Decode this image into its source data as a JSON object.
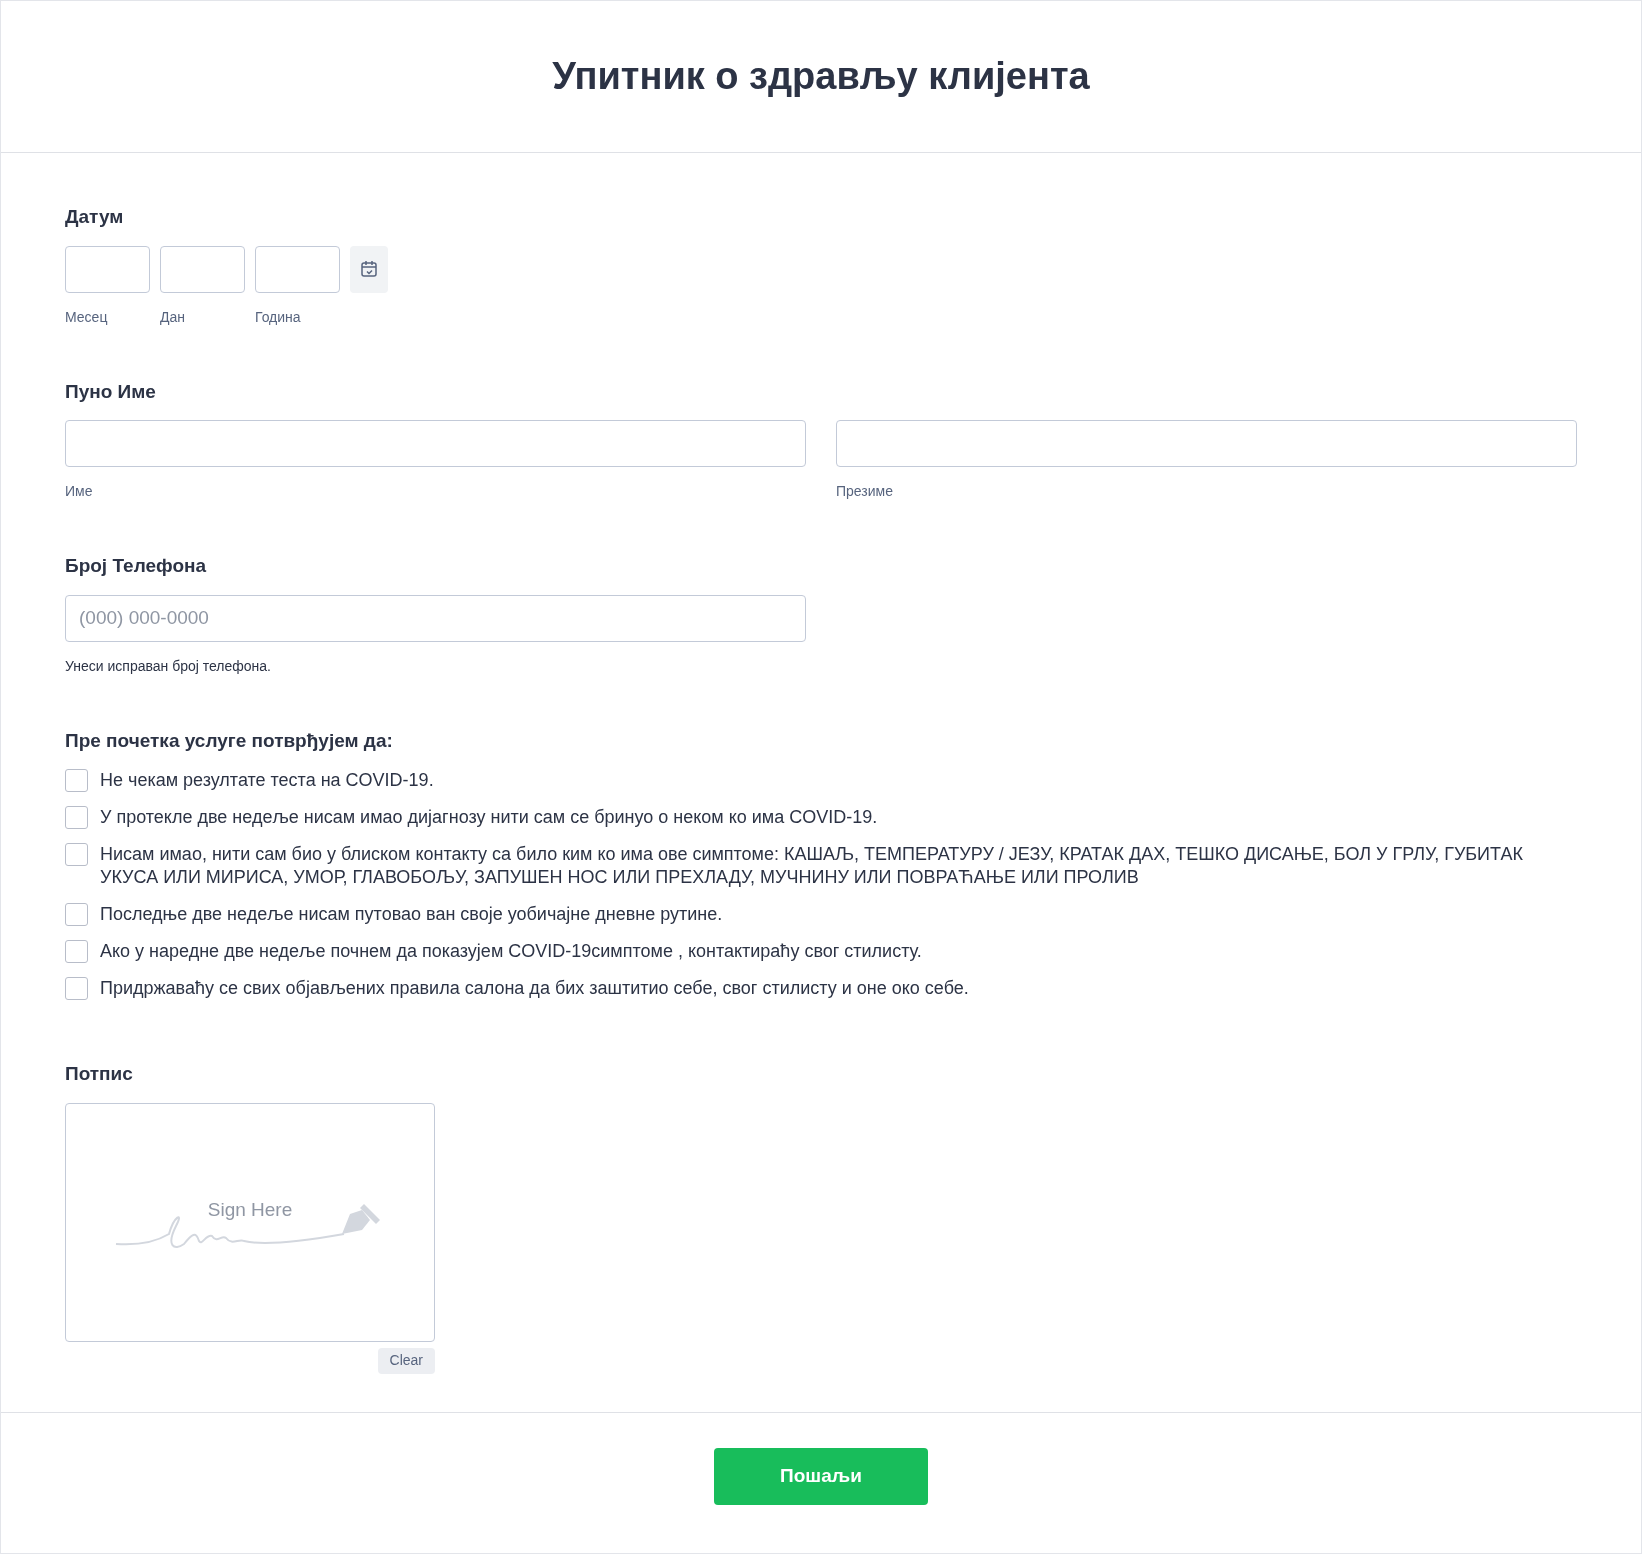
{
  "title": "Упитник о здрављу клијента",
  "date": {
    "label": "Датум",
    "parts": [
      {
        "sublabel": "Месец"
      },
      {
        "sublabel": "Дан"
      },
      {
        "sublabel": "Година"
      }
    ]
  },
  "full_name": {
    "label": "Пуно Име",
    "parts": [
      {
        "sublabel": "Име"
      },
      {
        "sublabel": "Презиме"
      }
    ]
  },
  "phone": {
    "label": "Број Телефона",
    "placeholder": "(000) 000-0000",
    "help": "Унеси исправан број телефона."
  },
  "confirm": {
    "label": "Пре почетка услуге потврђујем да:",
    "items": [
      {
        "text": "Не чекам резултате теста на COVID-19.",
        "checked": false
      },
      {
        "text": "У протекле две недеље нисам имао дијагнозу нити сам се бринуо о неком ко има COVID-19.",
        "checked": false
      },
      {
        "text": "Нисам имао, нити сам био у блиском контакту са било ким ко има ове симптоме: КАШАЉ, ТЕМПЕРАТУРУ / ЈЕЗУ, КРАТАК ДАХ, ТЕШКО ДИСАЊЕ, БОЛ У ГРЛУ, ГУБИТАК УКУСА ИЛИ МИРИСА, УМОР, ГЛАВОБОЉУ, ЗАПУШЕН НОС ИЛИ ПРЕХЛАДУ, МУЧНИНУ ИЛИ ПОВРАЋАЊЕ ИЛИ ПРОЛИВ",
        "checked": false
      },
      {
        "text": "Последње две недеље нисам путовао ван своје уобичајне дневне рутине.",
        "checked": false
      },
      {
        "text": "Ако у наредне две недеље почнем да показујем COVID-19симптоме , контактираћу свог стилисту.",
        "checked": false
      },
      {
        "text": "Придржаваћу се свих објављених правила салона да бих заштитио себе, свог стилисту и оне око себе.",
        "checked": false
      }
    ]
  },
  "signature": {
    "label": "Потпис",
    "hint": "Sign Here",
    "clear": "Clear"
  },
  "submit": "Пошаљи"
}
